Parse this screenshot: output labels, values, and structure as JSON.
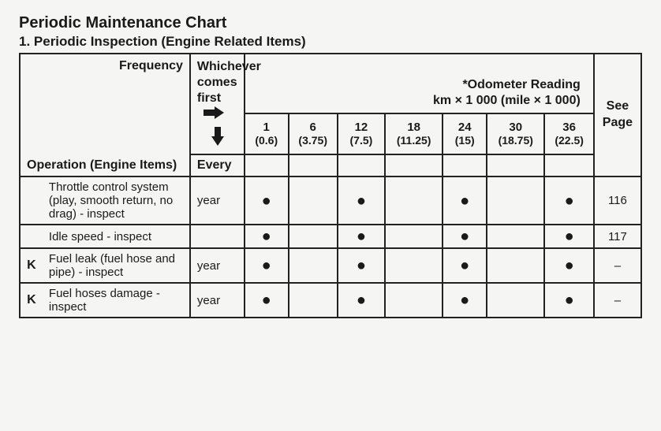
{
  "title": "Periodic Maintenance Chart",
  "subtitle": "1. Periodic Inspection (Engine Related Items)",
  "header": {
    "frequency": "Frequency",
    "whichever_line1": "Whichever",
    "whichever_line2": "comes",
    "whichever_line3": "first",
    "odometer_line1": "*Odometer Reading",
    "odometer_line2": "km × 1 000 (mile × 1 000)",
    "see_page_line1": "See",
    "see_page_line2": "Page",
    "operation_header": "Operation (Engine Items)",
    "every_header": "Every"
  },
  "columns": [
    {
      "main": "1",
      "sub": "(0.6)"
    },
    {
      "main": "6",
      "sub": "(3.75)"
    },
    {
      "main": "12",
      "sub": "(7.5)"
    },
    {
      "main": "18",
      "sub": "(11.25)"
    },
    {
      "main": "24",
      "sub": "(15)"
    },
    {
      "main": "30",
      "sub": "(18.75)"
    },
    {
      "main": "36",
      "sub": "(22.5)"
    }
  ],
  "rows": [
    {
      "k": "",
      "operation": "Throttle control system (play, smooth return, no drag) - inspect",
      "every": "year",
      "marks": [
        "●",
        "",
        "●",
        "",
        "●",
        "",
        "●"
      ],
      "page": "116"
    },
    {
      "k": "",
      "operation": "Idle speed - inspect",
      "every": "",
      "marks": [
        "●",
        "",
        "●",
        "",
        "●",
        "",
        "●"
      ],
      "page": "117"
    },
    {
      "k": "K",
      "operation": "Fuel leak (fuel hose and pipe) - inspect",
      "every": "year",
      "marks": [
        "●",
        "",
        "●",
        "",
        "●",
        "",
        "●"
      ],
      "page": "–"
    },
    {
      "k": "K",
      "operation": "Fuel hoses damage - inspect",
      "every": "year",
      "marks": [
        "●",
        "",
        "●",
        "",
        "●",
        "",
        "●"
      ],
      "page": "–"
    }
  ]
}
